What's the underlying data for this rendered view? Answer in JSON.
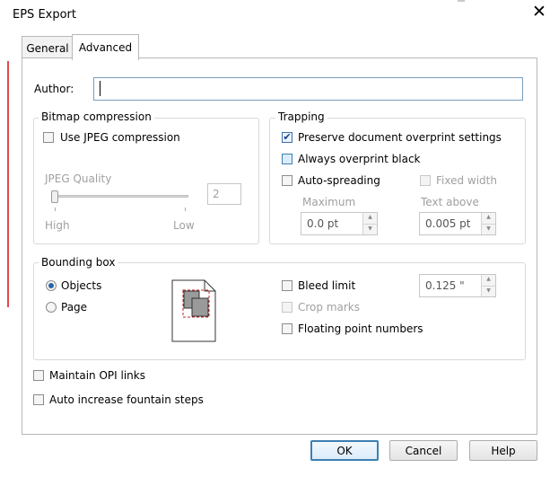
{
  "window": {
    "title": "EPS Export",
    "close_glyph": "✕"
  },
  "tabs": [
    {
      "label": "General",
      "active": false
    },
    {
      "label": "Advanced",
      "active": true
    }
  ],
  "author": {
    "label": "Author:",
    "value": ""
  },
  "bitmap": {
    "title": "Bitmap compression",
    "use_jpeg": {
      "label": "Use JPEG compression",
      "checked": false
    },
    "quality_label": "JPEG Quality",
    "quality_value": "2",
    "high": "High",
    "low": "Low",
    "slider_level": 0.0
  },
  "trapping": {
    "title": "Trapping",
    "preserve": {
      "label": "Preserve document overprint settings",
      "checked": true
    },
    "always_black": {
      "label": "Always overprint black",
      "checked": false
    },
    "auto_spread": {
      "label": "Auto-spreading",
      "checked": false
    },
    "fixed_width": {
      "label": "Fixed width",
      "checked": false
    },
    "maximum_label": "Maximum",
    "maximum_value": "0.0 pt",
    "text_above_label": "Text above",
    "text_above_value": "0.005 pt"
  },
  "bounding": {
    "title": "Bounding box",
    "objects": {
      "label": "Objects",
      "selected": true
    },
    "page": {
      "label": "Page",
      "selected": false
    },
    "bleed": {
      "label": "Bleed limit",
      "checked": false,
      "value": "0.125 \""
    },
    "crop": {
      "label": "Crop marks",
      "checked": false
    },
    "floating": {
      "label": "Floating point numbers",
      "checked": false
    }
  },
  "options": {
    "opi": {
      "label": "Maintain OPI links",
      "checked": false
    },
    "fountain": {
      "label": "Auto increase fountain steps",
      "checked": false
    }
  },
  "buttons": {
    "ok": "OK",
    "cancel": "Cancel",
    "help": "Help"
  },
  "colors": {
    "accent": "#3c7fb1",
    "input_border": "#7a9ebd",
    "preview_dash": "#c62828"
  }
}
